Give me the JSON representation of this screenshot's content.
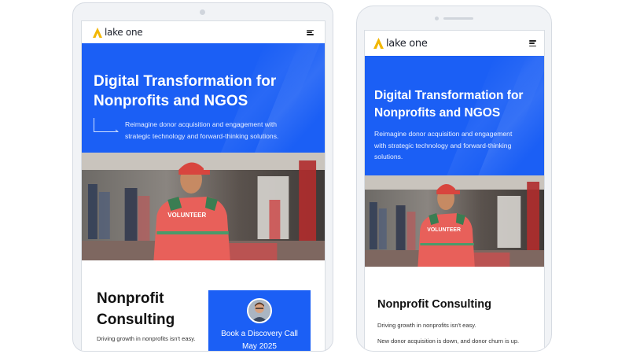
{
  "site": {
    "logo_text": "lake one",
    "hero_title_line1": "Digital Transformation for",
    "hero_title_line2": "Nonprofits and NGOS",
    "hero_subtitle_tablet_line1": "Reimagine donor acquisition and engagement with",
    "hero_subtitle_tablet_line2": "strategic technology and forward-thinking solutions.",
    "hero_subtitle_phone_line1": "Reimagine donor acquisition and engagement",
    "hero_subtitle_phone_line2": "with strategic technology and forward-thinking",
    "hero_subtitle_phone_line3": "solutions.",
    "photo_shirt_text": "VOLUNTEER",
    "section_title_tablet_line1": "Nonprofit",
    "section_title_tablet_line2": "Consulting",
    "section_title_phone": "Nonprofit Consulting",
    "section_text_1": "Driving growth in nonprofits isn't easy.",
    "section_text_2": "New donor acquisition is down, and donor churn is up.",
    "cta_label": "Book a Discovery Call",
    "cta_date": "May 2025"
  },
  "colors": {
    "brand_blue": "#1b5ff5",
    "logo_yellow": "#f2b705",
    "shirt_red": "#e8605a"
  }
}
